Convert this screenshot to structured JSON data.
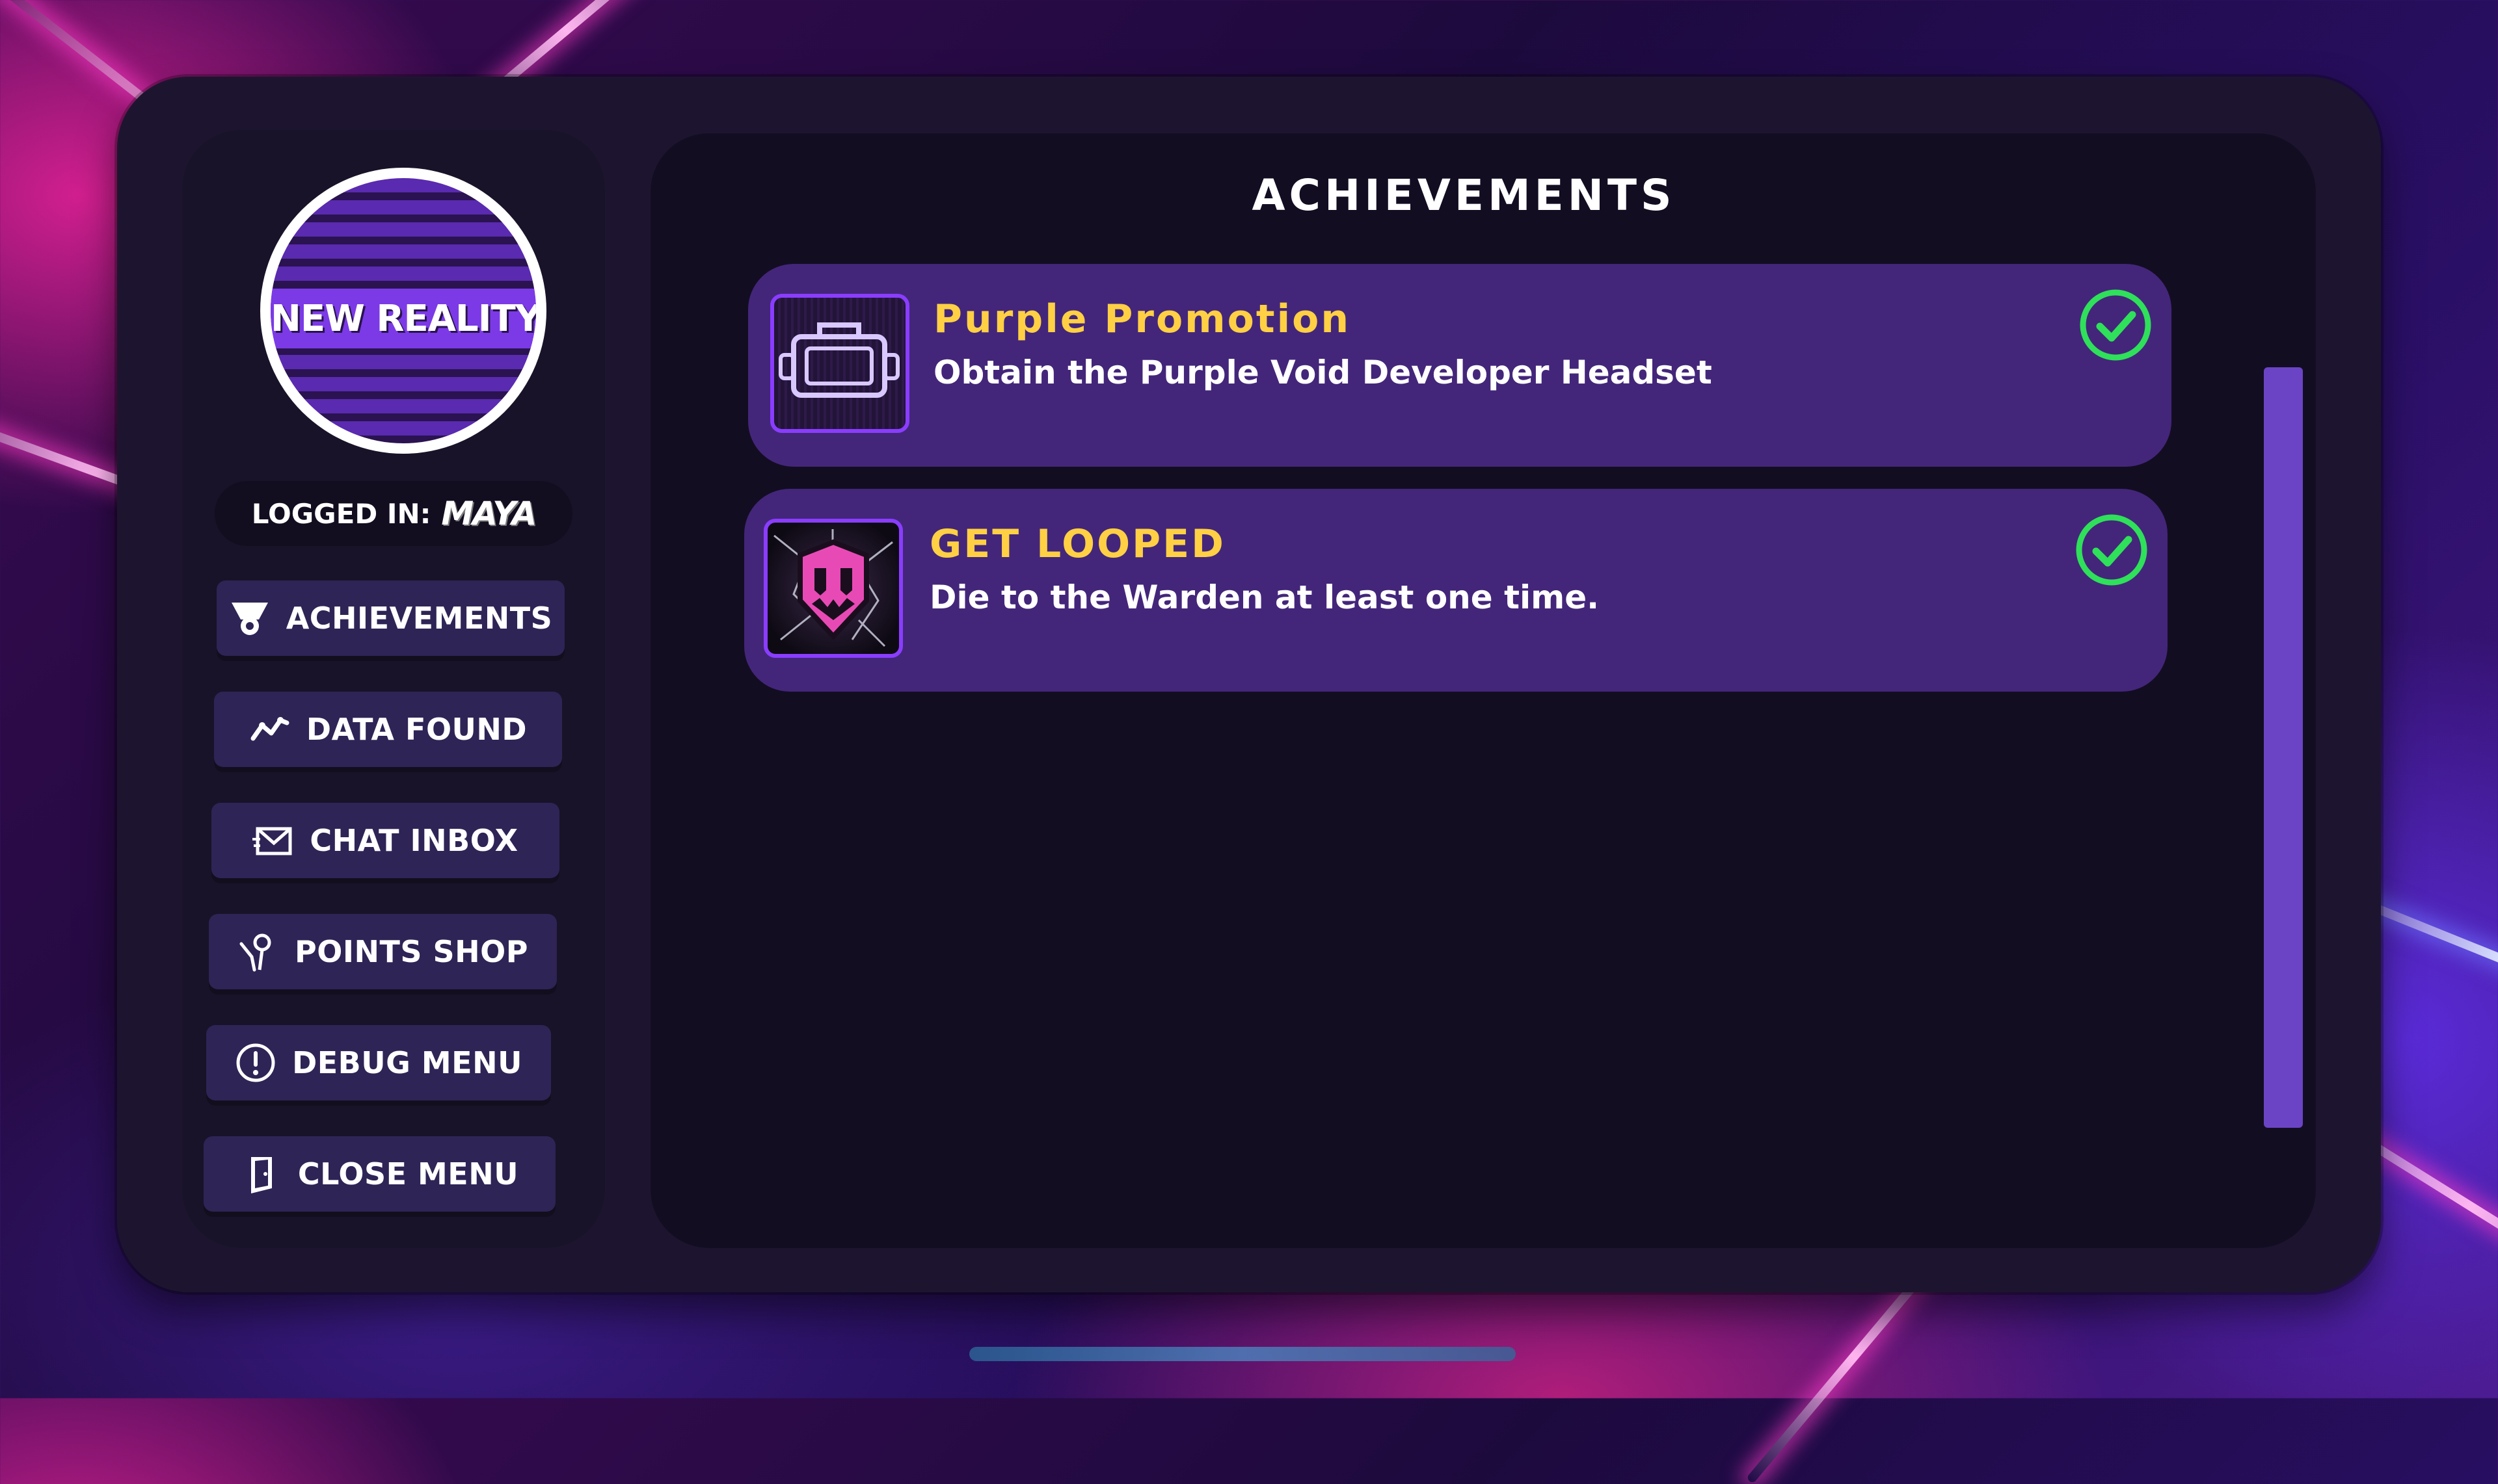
{
  "logo": {
    "text": "NEW REALITY"
  },
  "user": {
    "label": "LOGGED IN:",
    "name": "MAYA"
  },
  "nav": [
    {
      "label": "ACHIEVEMENTS",
      "icon": "medal-icon"
    },
    {
      "label": "DATA FOUND",
      "icon": "trend-line-icon"
    },
    {
      "label": "CHAT INBOX",
      "icon": "envelope-icon"
    },
    {
      "label": "POINTS SHOP",
      "icon": "person-pin-icon"
    },
    {
      "label": "DEBUG MENU",
      "icon": "exclamation-circle-icon"
    },
    {
      "label": "CLOSE MENU",
      "icon": "door-exit-icon"
    }
  ],
  "main": {
    "title": "ACHIEVEMENTS",
    "achievements": [
      {
        "title": "Purple Promotion",
        "description": "Obtain the Purple Void Developer Headset",
        "icon": "headset-icon",
        "completed": true
      },
      {
        "title": "GET LOOPED",
        "description": "Die to the Warden at least one time.",
        "icon": "warden-mask-icon",
        "completed": true
      }
    ]
  },
  "colors": {
    "accent_yellow": "#ffd044",
    "check_green": "#2fe05a",
    "button_bg": "#2f2456",
    "card_bg": "#43267a"
  }
}
